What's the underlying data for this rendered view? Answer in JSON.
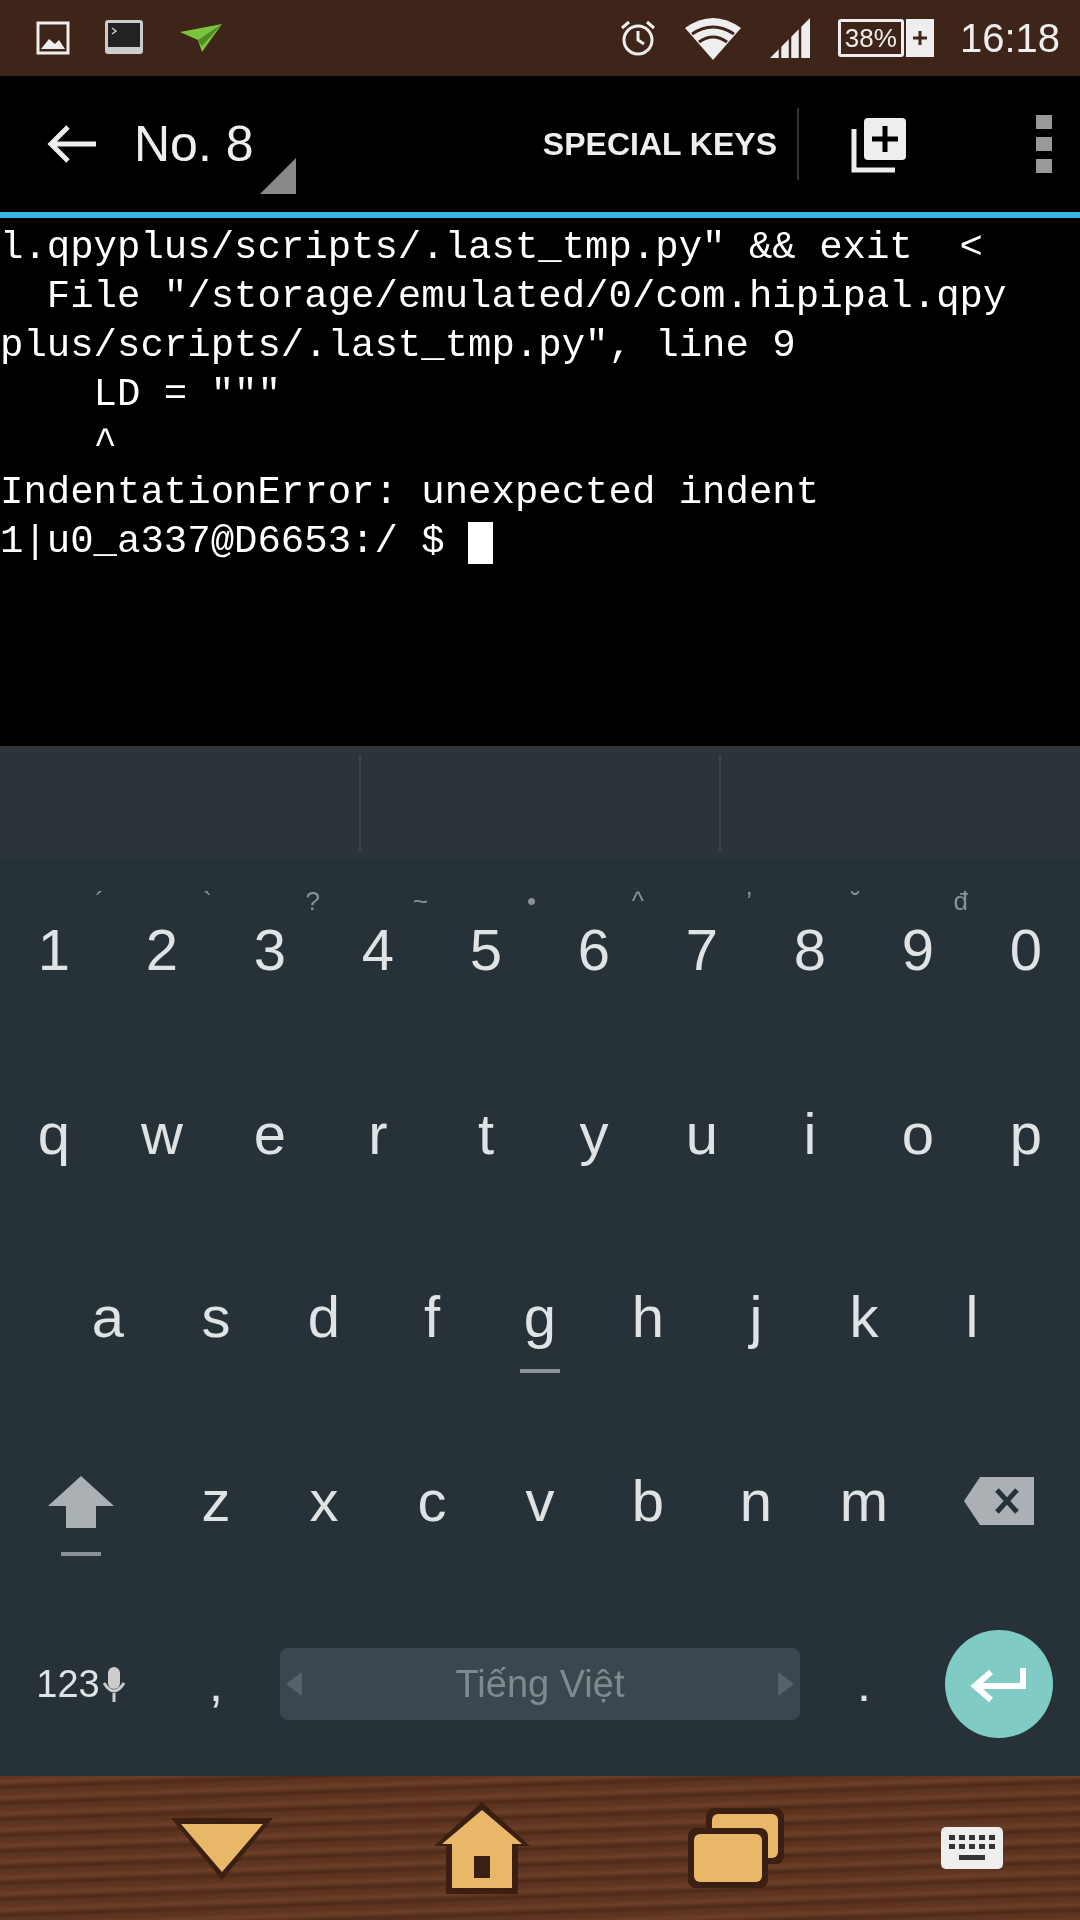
{
  "status_bar": {
    "battery": "38%",
    "time": "16:18"
  },
  "toolbar": {
    "title": "No. 8",
    "action": "SPECIAL KEYS"
  },
  "terminal": {
    "lines": [
      "l.qpyplus/scripts/.last_tmp.py\" && exit  <",
      "  File \"/storage/emulated/0/com.hipipal.qpy",
      "plus/scripts/.last_tmp.py\", line 9",
      "    LD = \"\"\"",
      "    ^",
      "IndentationError: unexpected indent"
    ],
    "prompt": "1|u0_a337@D6653:/ $ "
  },
  "keyboard": {
    "rows": [
      [
        {
          "label": "1",
          "hint": "´",
          "underlined": false
        },
        {
          "label": "2",
          "hint": "`",
          "underlined": false
        },
        {
          "label": "3",
          "hint": "?",
          "underlined": false
        },
        {
          "label": "4",
          "hint": "~",
          "underlined": false
        },
        {
          "label": "5",
          "hint": "•",
          "underlined": false
        },
        {
          "label": "6",
          "hint": "^",
          "underlined": false
        },
        {
          "label": "7",
          "hint": "’",
          "underlined": false
        },
        {
          "label": "8",
          "hint": "˘",
          "underlined": false
        },
        {
          "label": "9",
          "hint": "đ",
          "underlined": false
        },
        {
          "label": "0",
          "underlined": false
        }
      ],
      [
        {
          "label": "q",
          "underlined": false
        },
        {
          "label": "w",
          "underlined": false
        },
        {
          "label": "e",
          "underlined": false
        },
        {
          "label": "r",
          "underlined": false
        },
        {
          "label": "t",
          "underlined": false
        },
        {
          "label": "y",
          "underlined": false
        },
        {
          "label": "u",
          "underlined": false
        },
        {
          "label": "i",
          "underlined": false
        },
        {
          "label": "o",
          "underlined": false
        },
        {
          "label": "p",
          "underlined": false
        }
      ],
      [
        {
          "label": "a",
          "underlined": false
        },
        {
          "label": "s",
          "underlined": false
        },
        {
          "label": "d",
          "underlined": false
        },
        {
          "label": "f",
          "underlined": false
        },
        {
          "label": "g",
          "underlined": true
        },
        {
          "label": "h",
          "underlined": false
        },
        {
          "label": "j",
          "underlined": false
        },
        {
          "label": "k",
          "underlined": false
        },
        {
          "label": "l",
          "underlined": false
        }
      ],
      [
        {
          "label": "z",
          "underlined": false
        },
        {
          "label": "x",
          "underlined": false
        },
        {
          "label": "c",
          "underlined": false
        },
        {
          "label": "v",
          "underlined": false
        },
        {
          "label": "b",
          "underlined": false
        },
        {
          "label": "n",
          "underlined": false
        },
        {
          "label": "m",
          "underlined": false
        }
      ]
    ],
    "shift_underlined": true,
    "symbols_key": "123",
    "comma": ",",
    "space": "Tiếng Việt",
    "period": "."
  }
}
